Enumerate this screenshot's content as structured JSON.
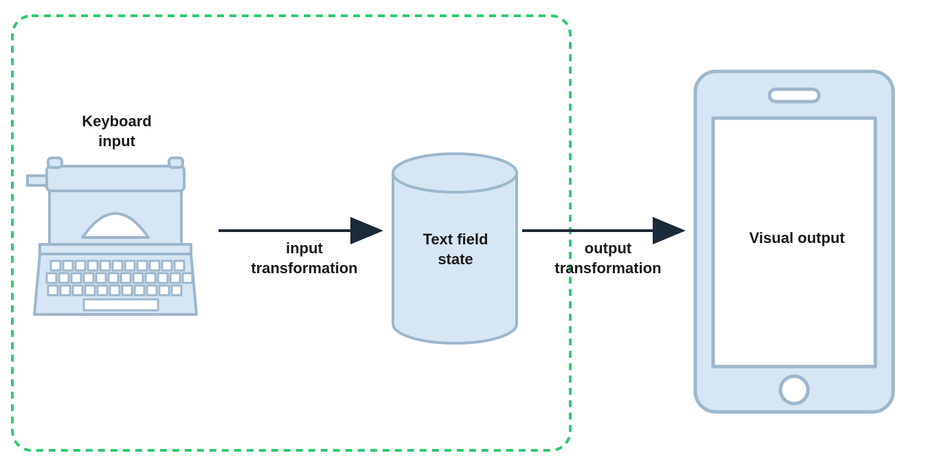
{
  "nodes": {
    "keyboard": {
      "label_line1": "Keyboard",
      "label_line2": "input"
    },
    "state": {
      "label_line1": "Text field",
      "label_line2": "state"
    },
    "output": {
      "label": "Visual output"
    }
  },
  "edges": {
    "input": {
      "label_line1": "input",
      "label_line2": "transformation"
    },
    "output": {
      "label_line1": "output",
      "label_line2": "transformation"
    }
  },
  "colors": {
    "node_fill": "#d7e6f4",
    "node_stroke": "#9db7cc",
    "arrow": "#1b2a38",
    "dashed_box": "#2ecb71"
  }
}
